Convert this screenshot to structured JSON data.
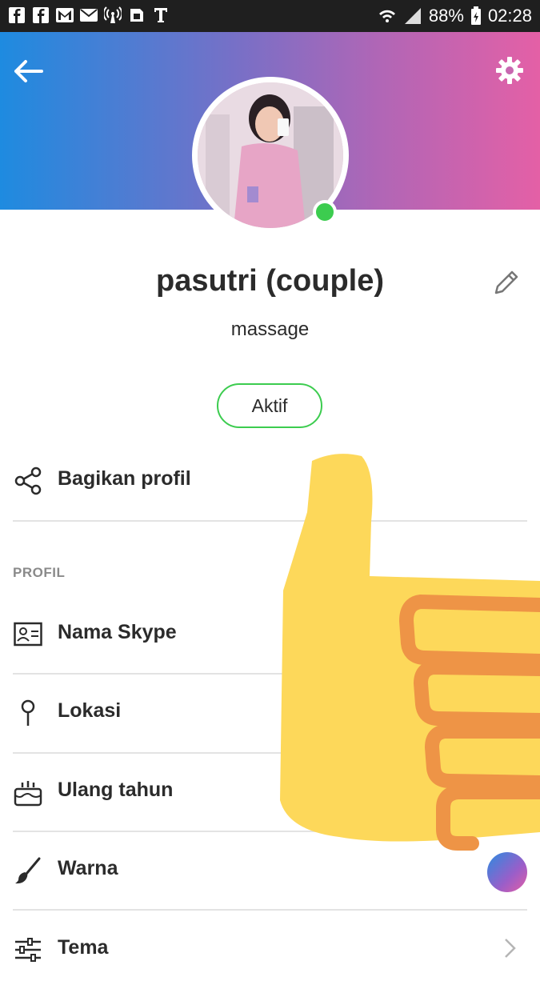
{
  "status_bar": {
    "left_icons": [
      "facebook-icon",
      "facebook-icon",
      "gmail-icon",
      "mail-icon",
      "hotspot-icon",
      "sim-icon",
      "tmobile-icon"
    ],
    "battery": "88%",
    "time": "02:28"
  },
  "profile": {
    "display_name": "pasutri (couple)",
    "mood": "massage",
    "status_button": "Aktif",
    "presence_color": "#3ccc4f"
  },
  "actions": {
    "share_label": "Bagikan profil"
  },
  "section": {
    "title": "PROFIL",
    "items": [
      {
        "label": "Nama Skype",
        "icon": "contact-card-icon"
      },
      {
        "label": "Lokasi",
        "icon": "location-pin-icon"
      },
      {
        "label": "Ulang tahun",
        "icon": "birthday-cake-icon"
      },
      {
        "label": "Warna",
        "icon": "paintbrush-icon"
      },
      {
        "label": "Tema",
        "icon": "sliders-icon"
      }
    ]
  },
  "colors": {
    "header_gradient": [
      "#1e8be0",
      "#7a6fc6",
      "#e460a6"
    ],
    "accent_green": "#3ccc4f",
    "thumb_yellow": "#fdd85a",
    "thumb_orange": "#ee9446"
  }
}
